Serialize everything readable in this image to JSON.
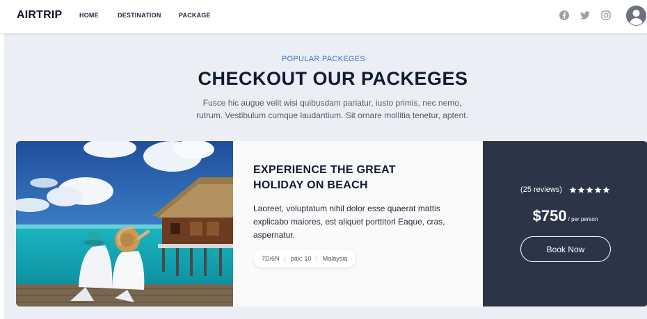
{
  "navbar": {
    "brand": "AIRTRIP",
    "links": [
      "HOME",
      "DESTINATION",
      "PACKAGE"
    ],
    "social_icons": [
      "facebook-icon",
      "twitter-icon",
      "instagram-icon"
    ],
    "avatar_icon": "user-avatar-icon"
  },
  "section": {
    "eyebrow": "POPULAR PACKEGES",
    "heading": "CHECKOUT OUR PACKEGES",
    "subtext_line1": "Fusce hic augue velit wisi quibusdam pariatur, iusto primis, nec nemo,",
    "subtext_line2": "rutrum. Vestibulum cumque laudantium. Sit ornare mollitia tenetur, aptent."
  },
  "package": {
    "title_line1": "EXPERIENCE THE GREAT",
    "title_line2": "HOLIDAY ON BEACH",
    "description_line1": "Laoreet, voluptatum nihil dolor esse quaerat mattis",
    "description_line2": "explicabo maiores, est aliquet porttitorl Eaque, cras,",
    "description_line3": "aspernatur.",
    "tags": [
      "7D/6N",
      "pax: 10",
      "Malaysia"
    ],
    "reviews": "(25 reviews)",
    "rating": 5,
    "price": "$750",
    "per_person": "/ per person",
    "book_label": "Book Now"
  },
  "colors": {
    "accent": "#3b73c4",
    "price_panel": "#2b3547",
    "section_bg": "#eceef5",
    "heading": "#0f1b33"
  }
}
